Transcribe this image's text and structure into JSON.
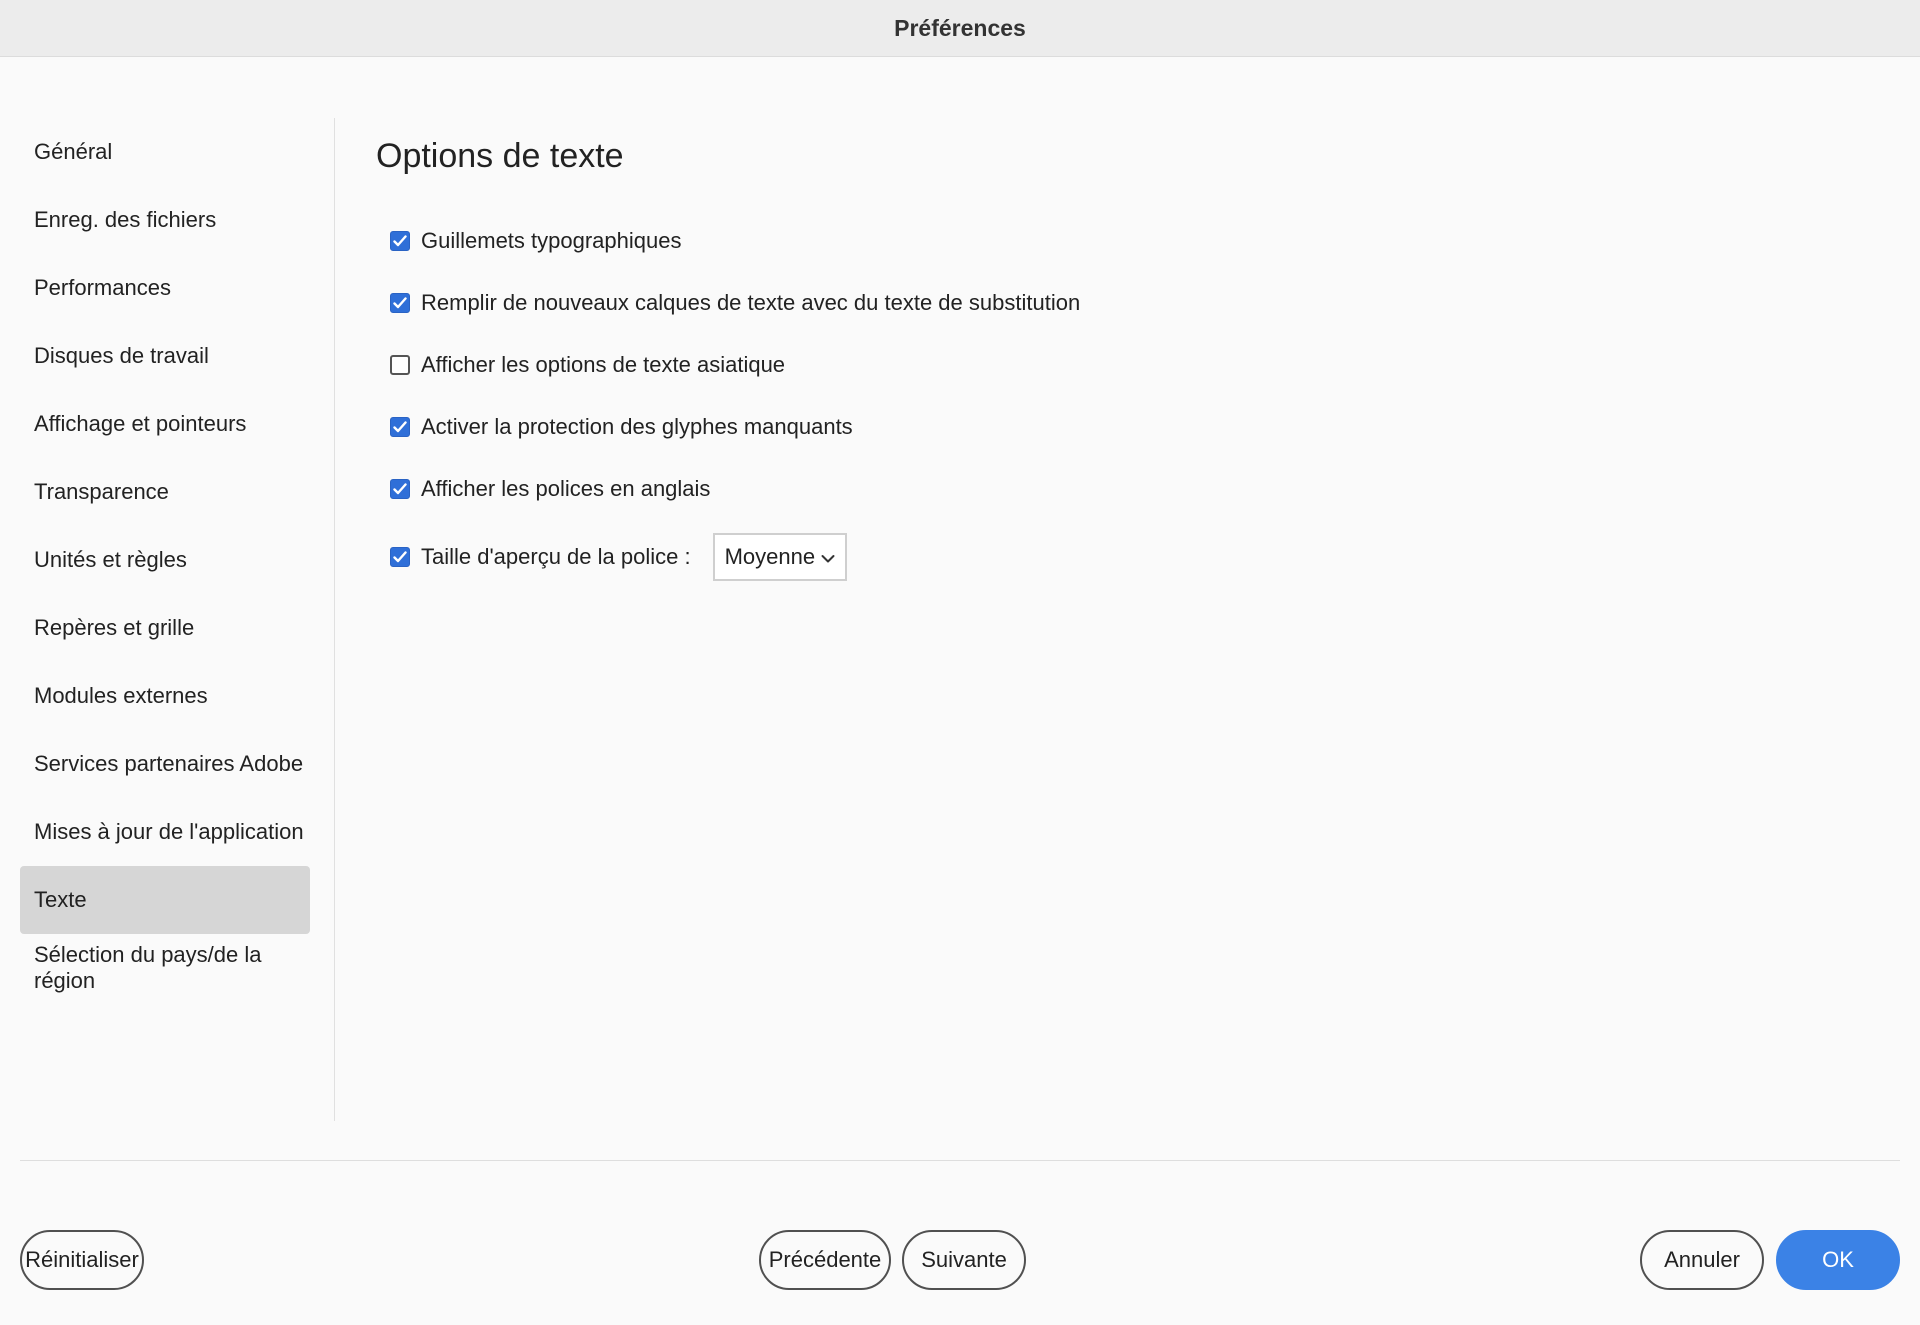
{
  "window": {
    "title": "Préférences"
  },
  "sidebar": {
    "items": [
      {
        "label": "Général",
        "selected": false
      },
      {
        "label": "Enreg. des fichiers",
        "selected": false
      },
      {
        "label": "Performances",
        "selected": false
      },
      {
        "label": "Disques de travail",
        "selected": false
      },
      {
        "label": "Affichage et pointeurs",
        "selected": false
      },
      {
        "label": "Transparence",
        "selected": false
      },
      {
        "label": "Unités et règles",
        "selected": false
      },
      {
        "label": "Repères et grille",
        "selected": false
      },
      {
        "label": "Modules externes",
        "selected": false
      },
      {
        "label": "Services partenaires Adobe",
        "selected": false
      },
      {
        "label": "Mises à jour de l'application",
        "selected": false
      },
      {
        "label": "Texte",
        "selected": true
      },
      {
        "label": "Sélection du pays/de la région",
        "selected": false
      }
    ]
  },
  "panel": {
    "title": "Options de texte",
    "options": [
      {
        "label": "Guillemets typographiques",
        "checked": true
      },
      {
        "label": "Remplir de nouveaux calques de texte avec du texte de substitution",
        "checked": true
      },
      {
        "label": "Afficher les options de texte asiatique",
        "checked": false
      },
      {
        "label": "Activer la protection des glyphes manquants",
        "checked": true
      },
      {
        "label": "Afficher les polices en anglais",
        "checked": true
      }
    ],
    "font_preview": {
      "label": "Taille d'aperçu de la police :",
      "checked": true,
      "selected": "Moyenne",
      "icon": "chevron-down-icon"
    }
  },
  "footer": {
    "reset_label": "Réinitialiser",
    "previous_label": "Précédente",
    "next_label": "Suivante",
    "cancel_label": "Annuler",
    "ok_label": "OK"
  },
  "colors": {
    "accent": "#3b82e6",
    "checkbox": "#2f6fd8",
    "selected_item": "#d6d6d6"
  }
}
